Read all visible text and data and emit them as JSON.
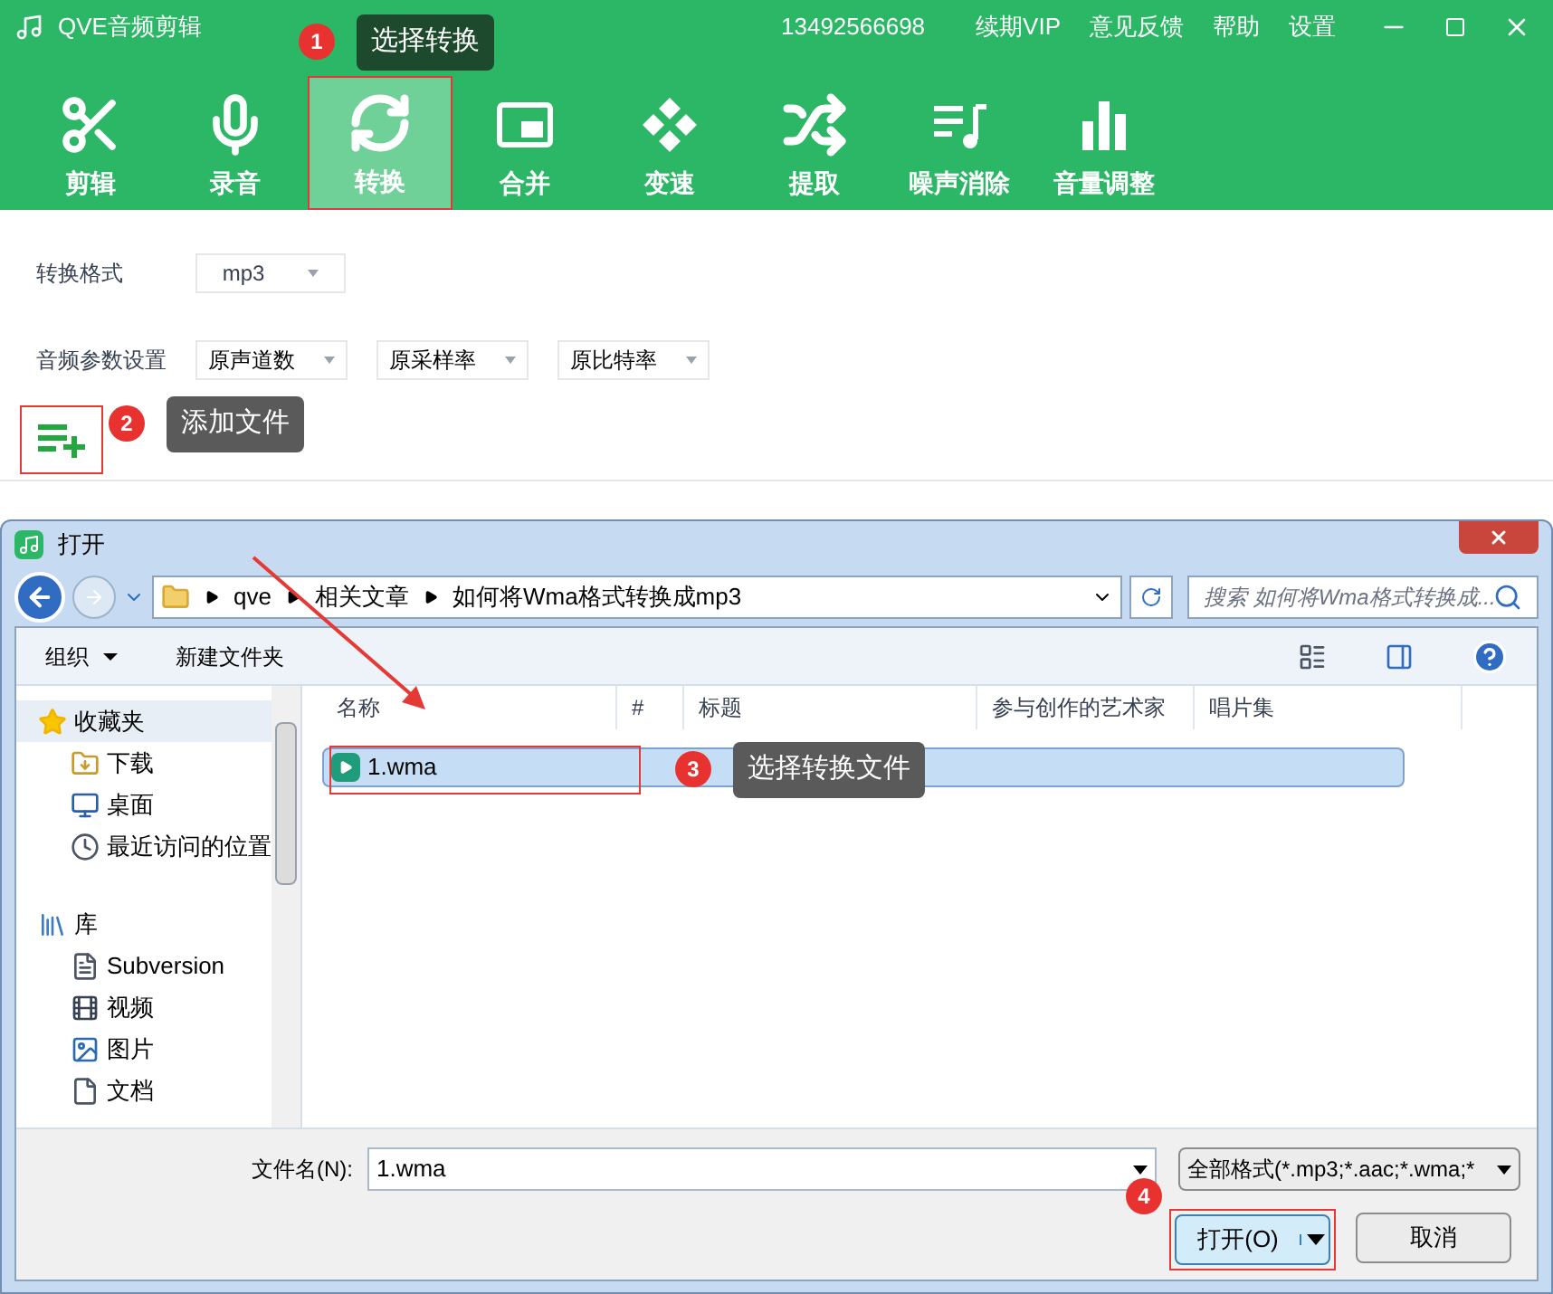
{
  "app": {
    "title": "QVE音频剪辑",
    "phone": "13492566698",
    "menu": [
      "续期VIP",
      "意见反馈",
      "帮助",
      "设置"
    ]
  },
  "toolbar": [
    {
      "label": "剪辑",
      "kind": "scissors",
      "selected": false
    },
    {
      "label": "录音",
      "kind": "mic",
      "selected": false
    },
    {
      "label": "转换",
      "kind": "convert",
      "selected": true
    },
    {
      "label": "合并",
      "kind": "merge",
      "selected": false
    },
    {
      "label": "变速",
      "kind": "speed",
      "selected": false
    },
    {
      "label": "提取",
      "kind": "shuffle",
      "selected": false
    },
    {
      "label": "噪声消除",
      "kind": "denoise",
      "selected": false
    },
    {
      "label": "音量调整",
      "kind": "volume",
      "selected": false
    }
  ],
  "settings": {
    "format_label": "转换格式",
    "format": "mp3",
    "params_label": "音频参数设置",
    "params": [
      "原声道数",
      "原采样率",
      "原比特率"
    ]
  },
  "callouts": [
    {
      "number": "1",
      "text": "选择转换"
    },
    {
      "number": "2",
      "text": "添加文件"
    },
    {
      "number": "3",
      "text": "选择转换文件"
    },
    {
      "number": "4"
    }
  ],
  "dialog": {
    "title": "打开",
    "path": [
      "qve",
      "相关文章",
      "如何将Wma格式转换成mp3"
    ],
    "search": {
      "placeholder": "搜索 如何将Wma格式转换成..."
    },
    "commands": [
      "组织",
      "新建文件夹"
    ],
    "nav": [
      {
        "label": "收藏夹",
        "kind": "star",
        "children": [
          {
            "label": "下载",
            "kind": "download"
          },
          {
            "label": "桌面",
            "kind": "desktop"
          },
          {
            "label": "最近访问的位置",
            "kind": "recent"
          }
        ]
      },
      {
        "label": "库",
        "kind": "library",
        "children": [
          {
            "label": "Subversion",
            "kind": "doc"
          },
          {
            "label": "视频",
            "kind": "film"
          },
          {
            "label": "图片",
            "kind": "image"
          },
          {
            "label": "文档",
            "kind": "file"
          }
        ]
      }
    ],
    "columns": [
      "名称",
      "#",
      "标题",
      "参与创作的艺术家",
      "唱片集"
    ],
    "files": [
      {
        "name": "1.wma",
        "selected": true
      }
    ],
    "filename_label": "文件名(N):",
    "filename": "1.wma",
    "filetype": "全部格式(*.mp3;*.aac;*.wma;*",
    "buttons": [
      "打开(O)",
      "取消"
    ]
  }
}
